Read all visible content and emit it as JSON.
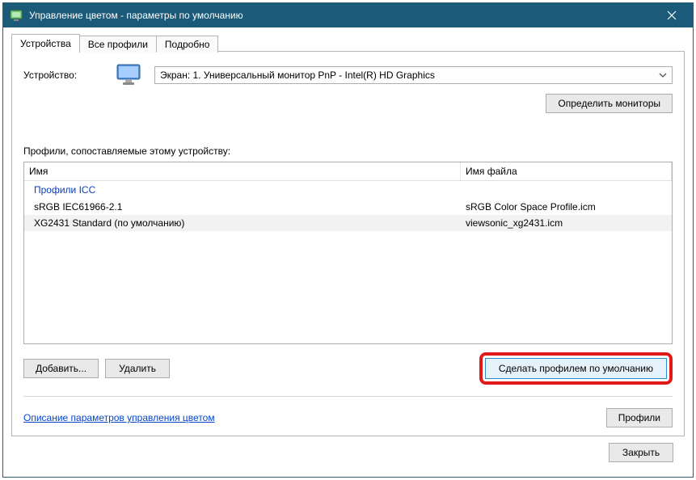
{
  "titlebar": {
    "title": "Управление цветом - параметры по умолчанию"
  },
  "tabs": {
    "devices": "Устройства",
    "all_profiles": "Все профили",
    "details": "Подробно"
  },
  "device": {
    "label": "Устройство:",
    "selected": "Экран: 1. Универсальный монитор PnP - Intel(R) HD Graphics",
    "identify_btn": "Определить мониторы"
  },
  "profiles": {
    "list_label": "Профили, сопоставляемые этому устройству:",
    "columns": {
      "name": "Имя",
      "file": "Имя файла"
    },
    "group": "Профили ICC",
    "rows": [
      {
        "name": "sRGB IEC61966-2.1",
        "file": "sRGB Color Space Profile.icm",
        "selected": false
      },
      {
        "name": "XG2431 Standard (по умолчанию)",
        "file": "viewsonic_xg2431.icm",
        "selected": true
      }
    ],
    "add_btn": "Добавить...",
    "remove_btn": "Удалить",
    "default_btn": "Сделать профилем по умолчанию"
  },
  "footer": {
    "help_link": "Описание параметров управления цветом",
    "profiles_btn": "Профили",
    "close_btn": "Закрыть"
  }
}
